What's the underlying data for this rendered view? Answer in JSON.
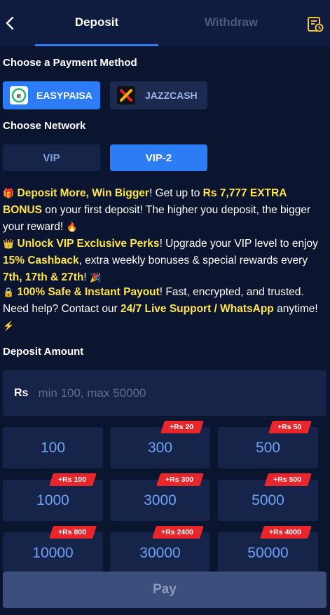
{
  "header": {
    "tabs": [
      {
        "label": "Deposit",
        "active": true
      },
      {
        "label": "Withdraw",
        "active": false
      }
    ]
  },
  "payment": {
    "title": "Choose a Payment Method",
    "methods": [
      {
        "label": "EASYPAISA",
        "icon": "easypaisa-logo",
        "selected": true
      },
      {
        "label": "JAZZCASH",
        "icon": "jazzcash-logo",
        "selected": false
      }
    ]
  },
  "network": {
    "title": "Choose Network",
    "options": [
      {
        "label": "VIP",
        "selected": false
      },
      {
        "label": "VIP-2",
        "selected": true
      }
    ]
  },
  "promo": {
    "p1": {
      "emoji": "🎁",
      "highlight1": "Deposit More, Win Bigger",
      "text1": "! Get up to ",
      "highlight2": "Rs 7,777 EXTRA BONUS",
      "text2": " on your first deposit! The higher you deposit, the bigger your reward! ",
      "emoji_end": "🔥"
    },
    "p2": {
      "emoji": "👑",
      "highlight1": "Unlock VIP Exclusive Perks",
      "text1": "! Upgrade your VIP level to enjoy ",
      "highlight2": "15% Cashback",
      "text2": ", extra weekly bonuses & special rewards every ",
      "highlight3": "7th, 17th & 27th",
      "text3": "! ",
      "emoji_end": "🎉"
    },
    "p3": {
      "emoji": "🔒",
      "highlight1": "100% Safe & Instant Payout",
      "text1": "! Fast, encrypted, and trusted. Need help? Contact our ",
      "highlight2": "24/7 Live Support / WhatsApp",
      "text2": " anytime! ",
      "emoji_end": "⚡"
    }
  },
  "amount": {
    "title": "Deposit Amount",
    "prefix": "Rs",
    "placeholder": "min 100, max 50000",
    "value": ""
  },
  "chips": [
    {
      "value": "100",
      "bonus": ""
    },
    {
      "value": "300",
      "bonus": "+Rs 20"
    },
    {
      "value": "500",
      "bonus": "+Rs 50"
    },
    {
      "value": "1000",
      "bonus": "+Rs 100"
    },
    {
      "value": "3000",
      "bonus": "+Rs 300"
    },
    {
      "value": "5000",
      "bonus": "+Rs 500"
    },
    {
      "value": "10000",
      "bonus": "+Rs 800"
    },
    {
      "value": "30000",
      "bonus": "+Rs 2400"
    },
    {
      "value": "50000",
      "bonus": "+Rs 4000"
    }
  ],
  "pay_label": "Pay",
  "colors": {
    "background": "#0b1530",
    "accent": "#2c7cf6",
    "highlight": "#ffe54a",
    "badge": "#e8262b",
    "chip_text": "#6fa2f5"
  }
}
